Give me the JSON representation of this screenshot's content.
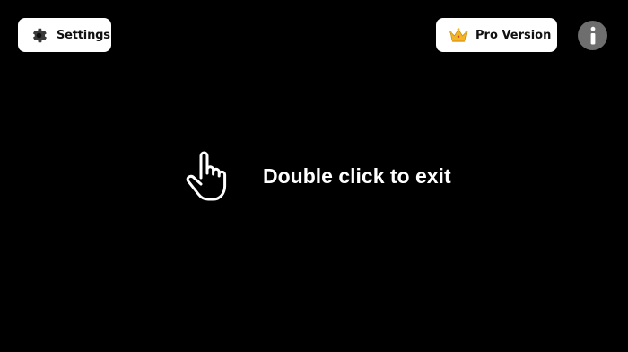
{
  "top_bar": {
    "settings": {
      "label": "Settings",
      "icon": "gear-icon"
    },
    "pro": {
      "label": "Pro Version",
      "icon": "crown-icon"
    },
    "info": {
      "icon": "info-icon"
    }
  },
  "main": {
    "hint_icon": "pointing-hand-icon",
    "hint_text": "Double click to exit"
  },
  "colors": {
    "background": "#000000",
    "button_bg": "#ffffff",
    "button_text": "#111111",
    "info_bg": "#6e6e6e",
    "crown": "#f2b625"
  }
}
